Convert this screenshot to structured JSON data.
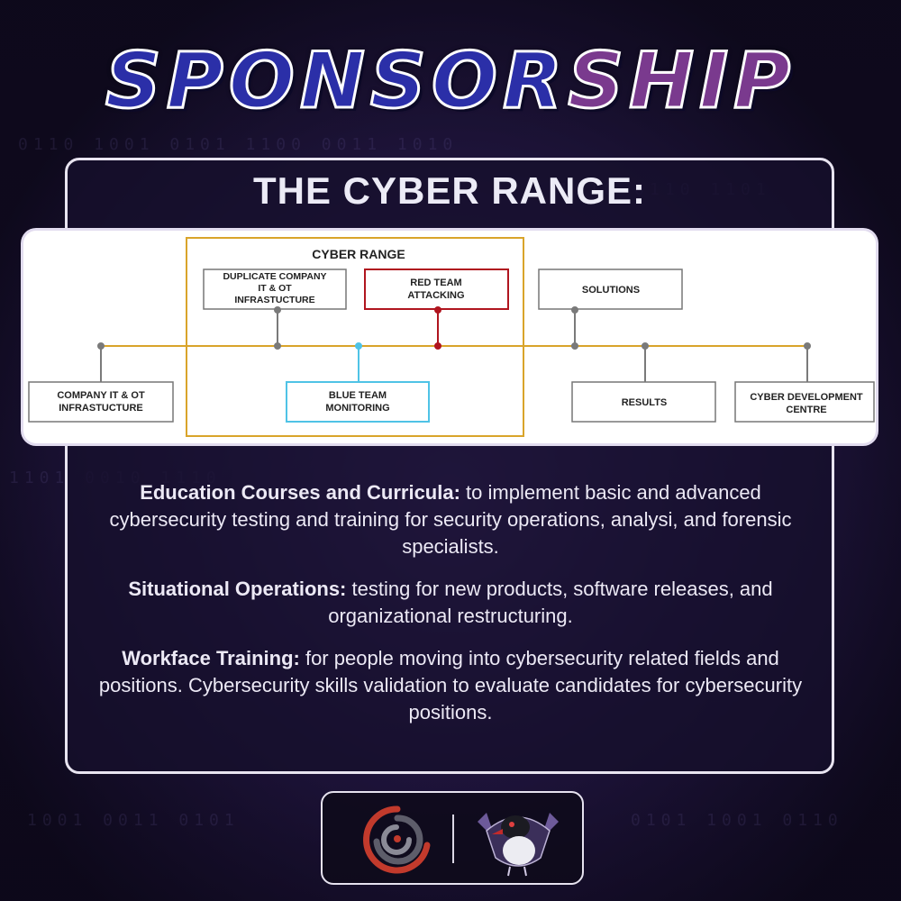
{
  "header": {
    "title_a": "SPONSOR",
    "title_b": "SHIP"
  },
  "panel": {
    "heading": "THE CYBER RANGE:"
  },
  "diagram": {
    "range_label": "CYBER RANGE",
    "duplicate_line1": "DUPLICATE COMPANY",
    "duplicate_line2": "IT & OT",
    "duplicate_line3": "INFRASTUCTURE",
    "red_line1": "RED TEAM",
    "red_line2": "ATTACKING",
    "solutions": "SOLUTIONS",
    "company_line1": "COMPANY IT & OT",
    "company_line2": "INFRASTUCTURE",
    "blue_line1": "BLUE TEAM",
    "blue_line2": "MONITORING",
    "results": "RESULTS",
    "cdc_line1": "CYBER DEVELOPMENT",
    "cdc_line2": "CENTRE"
  },
  "items": [
    {
      "label": "Education Courses and Curricula:",
      "text": " to implement basic and advanced cybersecurity testing and training for security operations, analysi, and forensic specialists."
    },
    {
      "label": "Situational Operations:",
      "text": " testing for new products, software releases, and organizational restructuring."
    },
    {
      "label": "Workface Training:",
      "text": " for people moving into cybersecurity related fields and positions. Cybersecurity skills validation to evaluate candidates for cybersecurity positions."
    }
  ],
  "colors": {
    "range_border": "#d9a42a",
    "red": "#b0151f",
    "blue": "#4fc3e6",
    "connector": "#7a7a7a"
  },
  "logos": {
    "left": "swirl-logo",
    "right": "bird-mascot-logo"
  }
}
